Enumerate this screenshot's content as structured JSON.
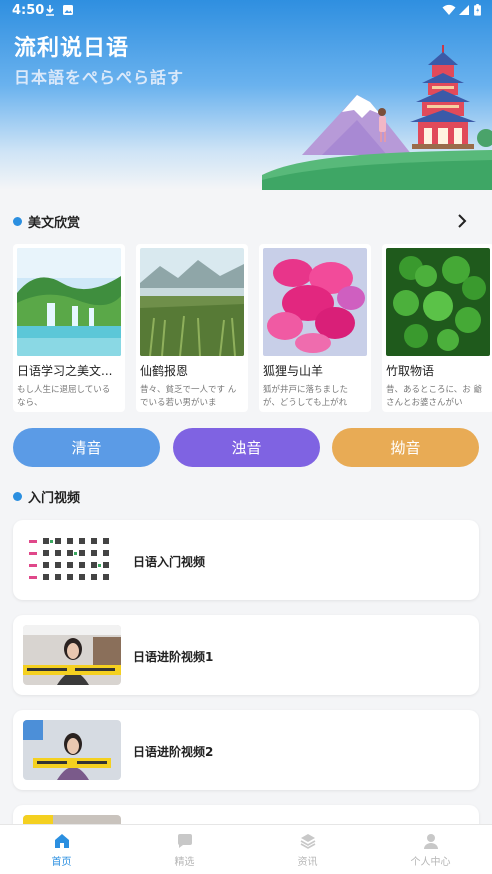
{
  "status": {
    "time": "4:50"
  },
  "hero": {
    "title": "流利说日语",
    "subtitle": "日本語をぺらぺら話す"
  },
  "essays": {
    "section_title": "美文欣赏",
    "items": [
      {
        "title": "日语学习之美文...",
        "desc": "もし人生に退屈している なら、",
        "thumb": "waterfall"
      },
      {
        "title": "仙鹤报恩",
        "desc": "昔々、貧乏で一人です んでいる若い男がいま",
        "thumb": "meadow"
      },
      {
        "title": "狐狸与山羊",
        "desc": "狐が井戸に落ちました が、どうしても上がれ",
        "thumb": "pink-flower"
      },
      {
        "title": "竹取物语",
        "desc": "昔、あるところに、お 爺さんとお婆さんがい",
        "thumb": "clover"
      }
    ]
  },
  "buttons": {
    "seion": "清音",
    "dakuon": "浊音",
    "youon": "拗音"
  },
  "colors": {
    "seion": "#5b9be6",
    "dakuon": "#7f63e2",
    "youon": "#e8ab55",
    "accent": "#2b8fe0"
  },
  "videos": {
    "section_title": "入门视频",
    "items": [
      {
        "title": "日语入门视频",
        "thumb": "kana-chart"
      },
      {
        "title": "日语进阶视频1",
        "thumb": "woman-video"
      },
      {
        "title": "日语进阶视频2",
        "thumb": "woman-video"
      },
      {
        "title": "",
        "thumb": "partial"
      }
    ]
  },
  "nav": [
    {
      "label": "首页",
      "icon": "home-icon",
      "active": true
    },
    {
      "label": "精选",
      "icon": "chat-icon",
      "active": false
    },
    {
      "label": "资讯",
      "icon": "layers-icon",
      "active": false
    },
    {
      "label": "个人中心",
      "icon": "person-icon",
      "active": false
    }
  ]
}
